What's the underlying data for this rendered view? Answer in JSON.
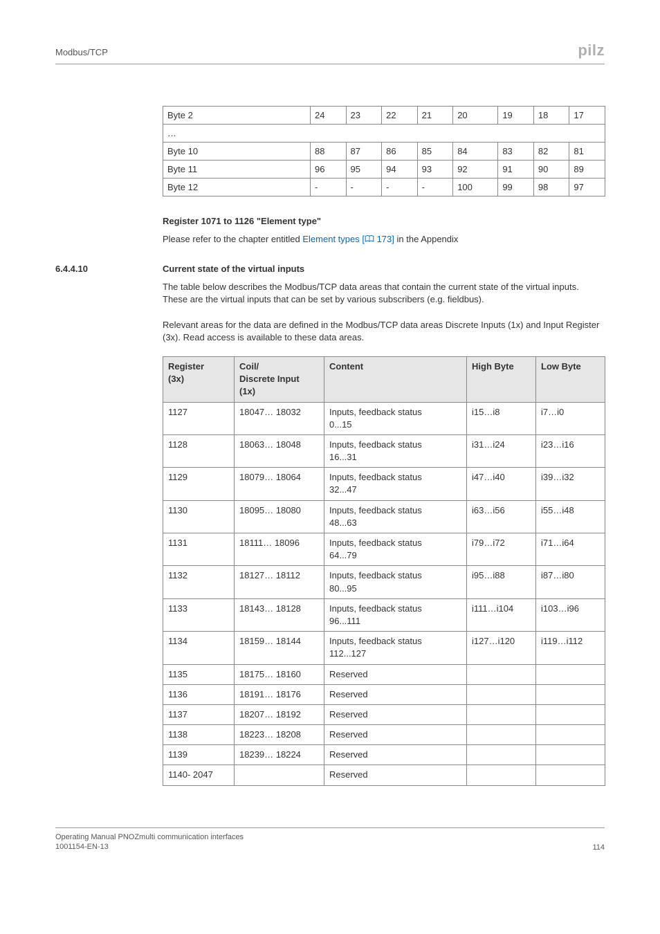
{
  "header": {
    "section": "Modbus/TCP",
    "logo": "pilz"
  },
  "bit_table": {
    "rows": [
      {
        "label": "Byte 2",
        "cells": [
          "24",
          "23",
          "22",
          "21",
          "20",
          "19",
          "18",
          "17"
        ]
      },
      {
        "label": "…",
        "ellipsis": true
      },
      {
        "label": "Byte 10",
        "cells": [
          "88",
          "87",
          "86",
          "85",
          "84",
          "83",
          "82",
          "81"
        ]
      },
      {
        "label": "Byte 11",
        "cells": [
          "96",
          "95",
          "94",
          "93",
          "92",
          "91",
          "90",
          "89"
        ]
      },
      {
        "label": "Byte 12",
        "cells": [
          "-",
          "-",
          "-",
          "-",
          "100",
          "99",
          "98",
          "97"
        ]
      }
    ]
  },
  "heading1": "Register 1071 to 1126 \"Element type\"",
  "para1_pre": "Please refer to the chapter entitled ",
  "para1_link": "Element types [",
  "para1_linkpage": " 173]",
  "para1_post": " in the Appendix",
  "subsec": {
    "num": "6.4.4.10",
    "title": "Current state of the virtual inputs"
  },
  "para2": "The table below describes the Modbus/TCP data areas that contain the current state of the virtual inputs. These are the virtual inputs that can be set by various subscribers (e.g. fieldbus).",
  "para3": "Relevant areas for the data are defined in the Modbus/TCP data areas Discrete Inputs (1x) and Input Register (3x). Read access is available to these data areas.",
  "reg_table": {
    "head": {
      "reg_l1": "Register",
      "reg_l2": "(3x)",
      "coil_l1": "Coil/",
      "coil_l2": "Discrete Input",
      "coil_l3": "(1x)",
      "content": "Content",
      "hb": "High Byte",
      "lb": "Low Byte"
    },
    "rows": [
      {
        "reg": "1127",
        "coil": "18047… 18032",
        "c1": "Inputs, feedback status",
        "c2": "0...15",
        "hb": "i15…i8",
        "lb": "i7…i0"
      },
      {
        "reg": "1128",
        "coil": "18063… 18048",
        "c1": "Inputs, feedback status",
        "c2": "16...31",
        "hb": "i31…i24",
        "lb": "i23…i16"
      },
      {
        "reg": "1129",
        "coil": "18079… 18064",
        "c1": "Inputs, feedback status",
        "c2": "32...47",
        "hb": "i47…i40",
        "lb": "i39…i32"
      },
      {
        "reg": "1130",
        "coil": "18095… 18080",
        "c1": "Inputs, feedback status",
        "c2": "48...63",
        "hb": "i63…i56",
        "lb": "i55…i48"
      },
      {
        "reg": "1131",
        "coil": "18111… 18096",
        "c1": "Inputs, feedback status",
        "c2": "64...79",
        "hb": "i79…i72",
        "lb": "i71…i64"
      },
      {
        "reg": "1132",
        "coil": "18127… 18112",
        "c1": "Inputs, feedback status",
        "c2": "80...95",
        "hb": "i95…i88",
        "lb": "i87…i80"
      },
      {
        "reg": "1133",
        "coil": "18143… 18128",
        "c1": "Inputs, feedback status",
        "c2": "96...111",
        "hb": "i111…i104",
        "lb": "i103…i96"
      },
      {
        "reg": "1134",
        "coil": "18159… 18144",
        "c1": "Inputs, feedback status",
        "c2": "112...127",
        "hb": "i127…i120",
        "lb": "i119…i112"
      },
      {
        "reg": "1135",
        "coil": "18175… 18160",
        "c1": "Reserved",
        "c2": "",
        "hb": "",
        "lb": ""
      },
      {
        "reg": "1136",
        "coil": "18191… 18176",
        "c1": "Reserved",
        "c2": "",
        "hb": "",
        "lb": ""
      },
      {
        "reg": "1137",
        "coil": "18207… 18192",
        "c1": "Reserved",
        "c2": "",
        "hb": "",
        "lb": ""
      },
      {
        "reg": "1138",
        "coil": "18223… 18208",
        "c1": "Reserved",
        "c2": "",
        "hb": "",
        "lb": ""
      },
      {
        "reg": "1139",
        "coil": "18239… 18224",
        "c1": "Reserved",
        "c2": "",
        "hb": "",
        "lb": ""
      },
      {
        "reg": "1140- 2047",
        "coil": "",
        "c1": "Reserved",
        "c2": "",
        "hb": "",
        "lb": ""
      }
    ]
  },
  "footer": {
    "line1": "Operating Manual PNOZmulti communication interfaces",
    "line2": "1001154-EN-13",
    "page": "114"
  }
}
